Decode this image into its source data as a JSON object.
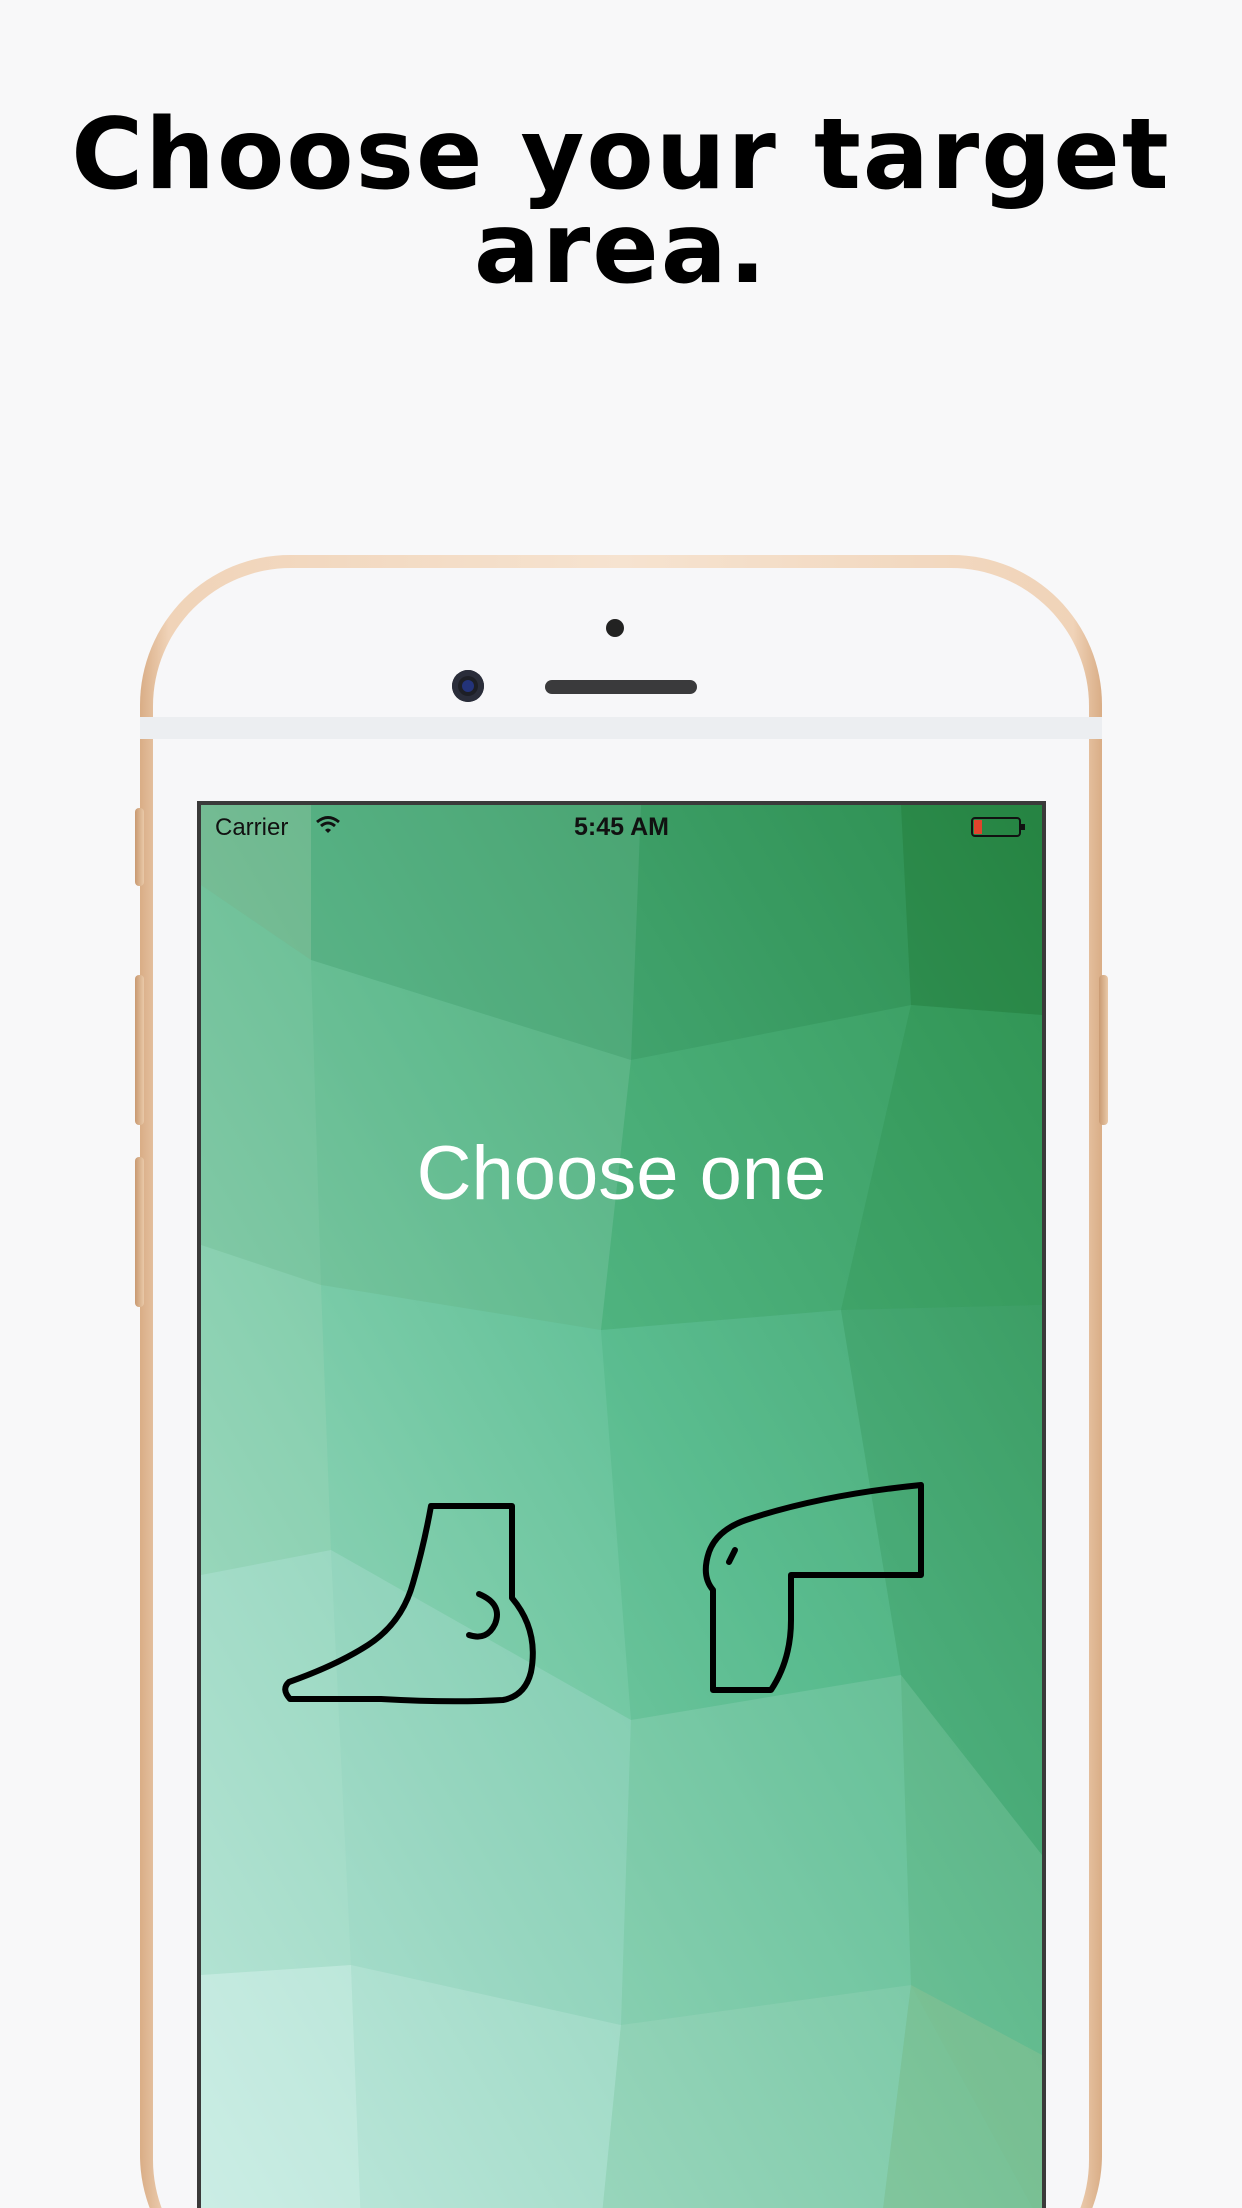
{
  "headline": "Choose your target area.",
  "status_bar": {
    "carrier": "Carrier",
    "time": "5:45 AM"
  },
  "screen": {
    "title": "Choose one"
  },
  "options": [
    {
      "name": "foot",
      "icon": "foot-icon"
    },
    {
      "name": "knee",
      "icon": "knee-icon"
    }
  ],
  "colors": {
    "page_background": "#f8f8f9",
    "screen_top": "#2e8f4e",
    "screen_bottom": "#c9ebe2",
    "icon_stroke": "#000000",
    "title_text": "#ffffff",
    "phone_frame": "#f0d3b8"
  }
}
